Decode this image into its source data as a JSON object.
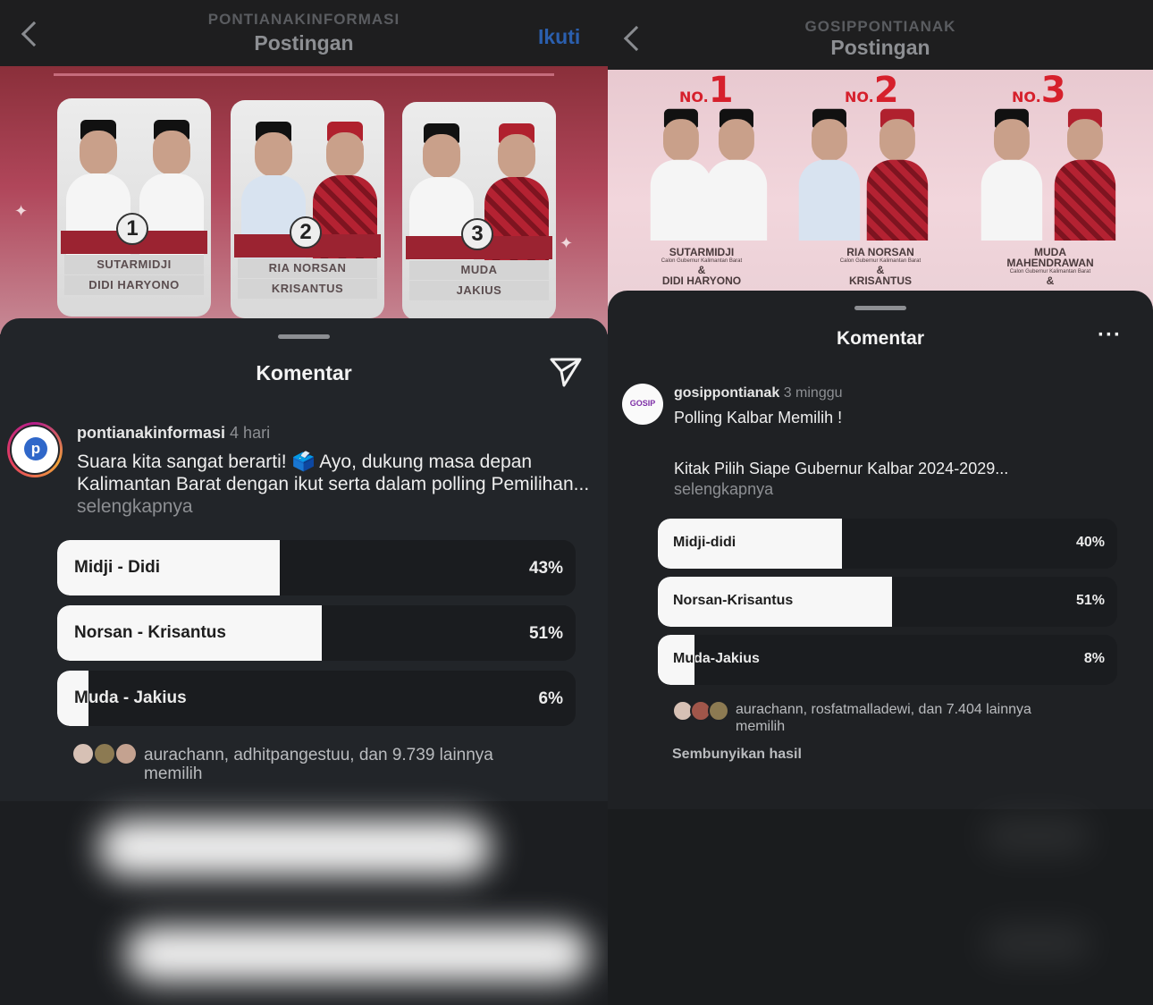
{
  "left": {
    "header": {
      "account": "PONTIANAKINFORMASI",
      "title": "Postingan",
      "follow_label": "Ikuti"
    },
    "banner": {
      "cards": [
        {
          "number": "1",
          "line1": "SUTARMIDJI",
          "line2": "DIDI HARYONO"
        },
        {
          "number": "2",
          "line1": "RIA NORSAN",
          "line2": "KRISANTUS"
        },
        {
          "number": "3",
          "line1": "MUDA",
          "line2": "JAKIUS"
        }
      ]
    },
    "sheet": {
      "title": "Komentar",
      "post": {
        "username": "pontianakinformasi",
        "time": "4 hari",
        "caption": "Suara kita sangat berarti! 🗳️ Ayo, dukung masa depan Kalimantan Barat dengan ikut serta dalam polling Pemilihan...",
        "more": "selengkapnya"
      },
      "poll": [
        {
          "label": "Midji - Didi",
          "percent": "43%",
          "value": 43
        },
        {
          "label": "Norsan - Krisantus",
          "percent": "51%",
          "value": 51
        },
        {
          "label": "Muda - Jakius",
          "percent": "6%",
          "value": 6
        }
      ],
      "voters_line1": "aurachann, adhitpangestuu, dan 9.739 lainnya",
      "voters_line2": "memilih"
    }
  },
  "right": {
    "header": {
      "account": "GOSIPPONTIANAK",
      "title": "Postingan"
    },
    "banner": {
      "numbers": [
        {
          "prefix": "NO.",
          "digit": "1"
        },
        {
          "prefix": "NO.",
          "digit": "2"
        },
        {
          "prefix": "NO.",
          "digit": "3"
        }
      ],
      "names": [
        {
          "line1": "SUTARMIDJI",
          "sub": "Calon Gubernur Kalimantan Barat",
          "amp": "&",
          "line2": "DIDI HARYONO"
        },
        {
          "line1": "RIA NORSAN",
          "sub": "Calon Gubernur Kalimantan Barat",
          "amp": "&",
          "line2": "KRISANTUS"
        },
        {
          "line1": "MUDA",
          "line1b": "MAHENDRAWAN",
          "sub": "Calon Gubernur Kalimantan Barat",
          "amp": "&"
        }
      ]
    },
    "sheet": {
      "title": "Komentar",
      "post": {
        "avatar_text": "GOSIP",
        "username": "gosippontianak",
        "time": "3 minggu",
        "caption_line1": "Polling Kalbar Memilih !",
        "caption_line2": "Kitak Pilih Siape Gubernur Kalbar 2024-2029...",
        "more": "selengkapnya"
      },
      "poll": [
        {
          "label": "Midji-didi",
          "percent": "40%",
          "value": 40
        },
        {
          "label": "Norsan-Krisantus",
          "percent": "51%",
          "value": 51
        },
        {
          "label": "Muda-Jakius",
          "percent": "8%",
          "value": 8
        }
      ],
      "voters_line1": "aurachann, rosfatmalladewi, dan 7.404 lainnya",
      "voters_line2": "memilih",
      "hide_results": "Sembunyikan hasil"
    }
  },
  "colors": {
    "accent_follow": "#2b5fae",
    "poll_fill": "#f7f7f7",
    "banner_red": "#9b2331"
  },
  "icons": {
    "back": "chevron-left-icon",
    "share": "paper-plane-icon",
    "options": "ellipsis-icon"
  }
}
